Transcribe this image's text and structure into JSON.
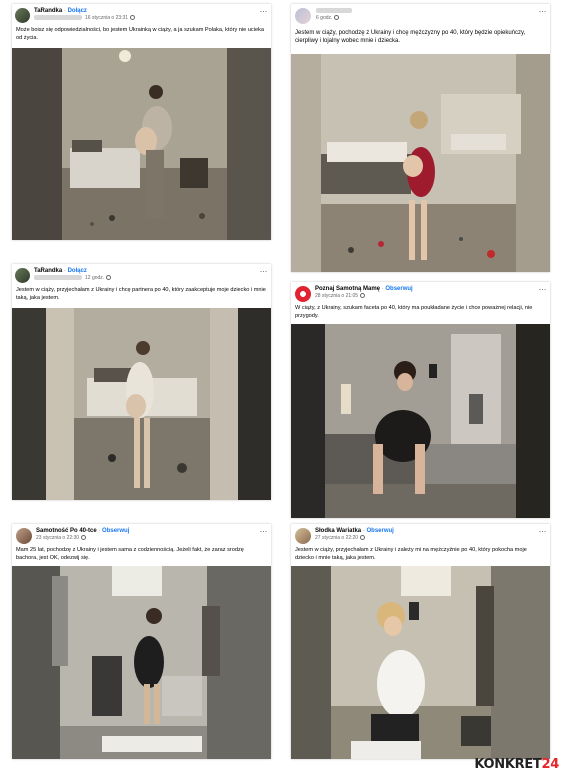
{
  "posts": [
    {
      "author": "TaRandka",
      "action": "Dołącz",
      "date": "16 stycznia o 23:31",
      "caption": "Może boisz się odpowiedzialności, bo jestem Ukrainką w ciąży, a ja szukam Polaka, który nie ucieka od życia.",
      "more": "···"
    },
    {
      "author": "",
      "action": "",
      "date": "6 godz.",
      "caption": "Jestem w ciąży, pochodzę z Ukrainy i chcę mężczyzny po 40, który będzie opiekuńczy, cierpliwy i lojalny wobec mnie i dziecka.",
      "more": "···"
    },
    {
      "author": "TaRandka",
      "action": "Dołącz",
      "date": "12 godz.",
      "caption": "Jestem w ciąży, przyjechałam z Ukrainy i chcę partnera po 40, który zaakceptuje moje dziecko i mnie taką, jaka jestem.",
      "more": "···"
    },
    {
      "author": "Poznaj Samotną Mamę",
      "action": "Obserwuj",
      "date": "28 stycznia o 21:05",
      "caption": "W ciąży, z Ukrainy, szukam faceta po 40, który ma poukładane życie i chce poważnej relacji, nie przygody.",
      "more": "···"
    },
    {
      "author": "Samotność Po 40-tce",
      "action": "Obserwuj",
      "date": "23 stycznia o 22:30",
      "caption": "Mam 25 lat, pochodzę z Ukrainy i jestem sama z codziennością. Jeżeli fakt, że zaraz srodzę bachora, jest OK, odezwij się.",
      "more": "···"
    },
    {
      "author": "Słodka Wariatka",
      "action": "Obserwuj",
      "date": "27 stycznia o 22:20",
      "caption": "Jestem w ciąży, przyjechałam z Ukrainy i zależy mi na mężczyźnie po 40, który pokocha moje dziecko i mnie taką, jaka jestem.",
      "more": "···"
    }
  ],
  "watermark": {
    "brand": "KONKRET",
    "number": "24"
  },
  "colors": {
    "link": "#1877f2",
    "meta": "#65676b",
    "watermark_accent": "#e8232a"
  }
}
